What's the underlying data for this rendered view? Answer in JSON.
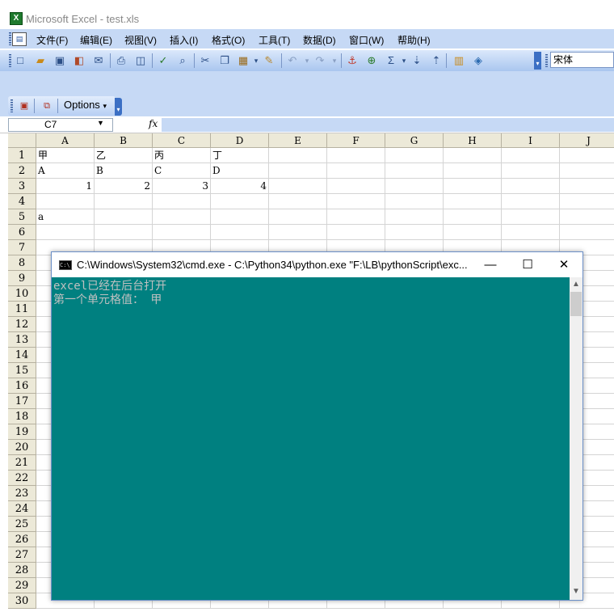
{
  "window": {
    "title": "Microsoft Excel - test.xls"
  },
  "menu": [
    "文件(F)",
    "编辑(E)",
    "视图(V)",
    "插入(I)",
    "格式(O)",
    "工具(T)",
    "数据(D)",
    "窗口(W)",
    "帮助(H)"
  ],
  "toolbar": {
    "icons": [
      "new-icon",
      "open-icon",
      "save-icon",
      "permission-icon",
      "email-icon",
      "print-icon",
      "print-preview-icon",
      "spelling-icon",
      "research-icon",
      "cut-icon",
      "copy-icon",
      "paste-icon",
      "format-painter-icon",
      "undo-icon",
      "redo-icon",
      "hyperlink-icon",
      "link-icon",
      "autosum-icon",
      "sort-ascending-icon",
      "sort-descending-icon",
      "chart-wizard-icon",
      "drawing-icon"
    ],
    "font_name": "宋体"
  },
  "options_bar": {
    "options_label": "Options"
  },
  "formula_bar": {
    "name_box": "C7",
    "fx": "fx",
    "formula": ""
  },
  "sheet": {
    "columns": [
      "A",
      "B",
      "C",
      "D",
      "E",
      "F",
      "G",
      "H",
      "I",
      "J"
    ],
    "rows": [
      "1",
      "2",
      "3",
      "4",
      "5",
      "6",
      "7",
      "8",
      "9",
      "10",
      "11",
      "12",
      "13",
      "14",
      "15",
      "16",
      "17",
      "18",
      "19",
      "20",
      "21",
      "22",
      "23",
      "24",
      "25",
      "26",
      "27",
      "28",
      "29",
      "30"
    ],
    "cells": {
      "A1": "甲",
      "B1": "乙",
      "C1": "丙",
      "D1": "丁",
      "A2": "A",
      "B2": "B",
      "C2": "C",
      "D2": "D",
      "A3": "1",
      "B3": "2",
      "C3": "3",
      "D3": "4",
      "A5": "a"
    }
  },
  "console": {
    "title": "C:\\Windows\\System32\\cmd.exe - C:\\Python34\\python.exe  \"F:\\LB\\pythonScript\\exc...",
    "minimize": "—",
    "maximize": "☐",
    "close": "✕",
    "lines": [
      "excel已经在后台打开",
      "第一个单元格值：  甲"
    ],
    "bg_color": "#008080",
    "text_color": "#c0c0c0"
  }
}
